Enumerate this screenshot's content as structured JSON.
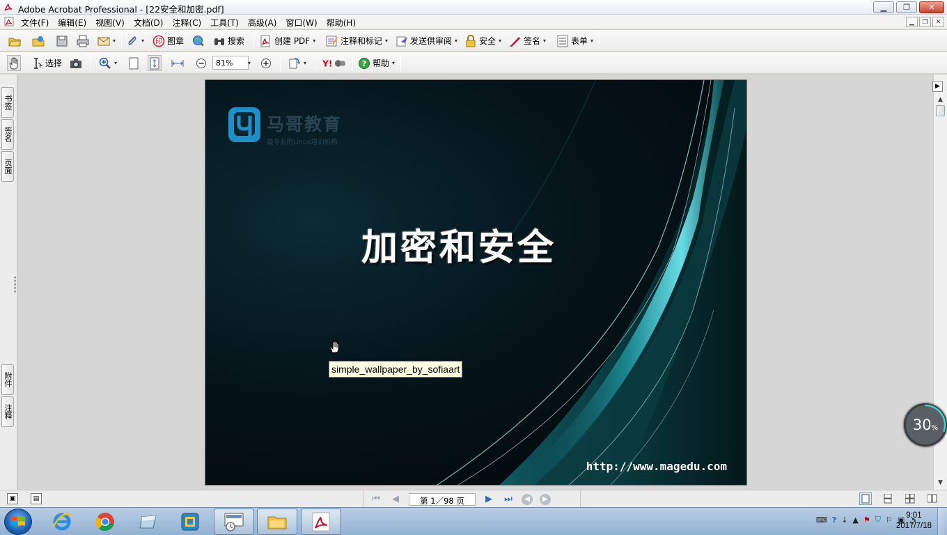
{
  "window": {
    "title": "Adobe Acrobat Professional - [22安全和加密.pdf]",
    "controls": [
      "minimize",
      "restore",
      "close"
    ]
  },
  "menubar": {
    "items": [
      "文件(F)",
      "编辑(E)",
      "视图(V)",
      "文档(D)",
      "注释(C)",
      "工具(T)",
      "高级(A)",
      "窗口(W)",
      "帮助(H)"
    ]
  },
  "toolbar1": {
    "stamp_label": "图章",
    "search_label": "搜索",
    "create_pdf_label": "创建 PDF",
    "comment_label": "注释和标记",
    "send_review_label": "发送供审阅",
    "security_label": "安全",
    "sign_label": "签名",
    "forms_label": "表单"
  },
  "toolbar2": {
    "select_label": "选择",
    "zoom_value": "81%",
    "help_label": "帮助"
  },
  "left_tabs": {
    "bookmarks": "书签",
    "signatures": "签名",
    "pages": "页面",
    "attachments": "附件",
    "comments": "注释"
  },
  "slide": {
    "logo_name": "马哥教育",
    "logo_slogan": "最专业的Linux培训机构",
    "title": "加密和安全",
    "url": "http://www.magedu.com"
  },
  "tooltip": {
    "text": "simple_wallpaper_by_sofiaart"
  },
  "badge": {
    "value": "30",
    "unit": "%",
    "progress": 0.3
  },
  "statusbar": {
    "page_display": "第 1／98 页",
    "current_page": 1,
    "total_pages": 98
  },
  "taskbar": {
    "time": "9:01",
    "date": "2017/7/18",
    "apps": [
      "ie",
      "chrome",
      "app-3",
      "app-4",
      "remote-desktop",
      "file-explorer",
      "acrobat"
    ]
  },
  "colors": {
    "accent_cyan": "#5fd6e0",
    "logo_blue": "#1f8fc8",
    "tooltip_bg": "#ffffe1"
  }
}
